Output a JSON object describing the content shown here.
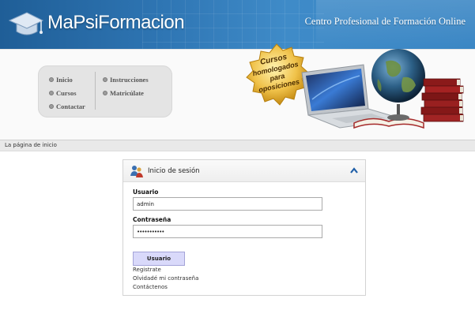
{
  "header": {
    "brand": "MaPsiFormacion",
    "tagline": "Centro Profesional de Formación Online"
  },
  "menu": {
    "items": [
      {
        "label": "Inicio"
      },
      {
        "label": "Cursos"
      },
      {
        "label": "Contactar"
      },
      {
        "label": "Instrucciones"
      },
      {
        "label": "Matricúlate"
      }
    ]
  },
  "promo": {
    "line1": "Cursos",
    "line2": "homologados",
    "line3": "para",
    "line4": "oposiciones"
  },
  "breadcrumb": "La página de inicio",
  "login": {
    "title": "Inicio de sesión",
    "username_label": "Usuario",
    "username_value": "admin",
    "password_label": "Contraseña",
    "password_value": "•••••••••••",
    "submit_label": "Usuario",
    "links": [
      "Registrate",
      "Olvidadé mi contraseña",
      "Contáctenos"
    ]
  },
  "colors": {
    "banner": "#2f76b4",
    "button": "#d9d9fa"
  }
}
